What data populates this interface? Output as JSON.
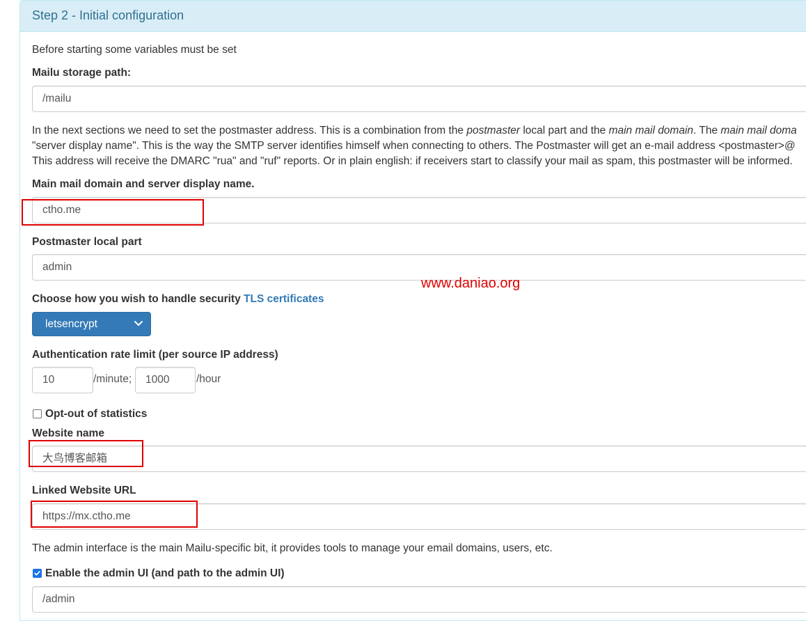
{
  "panel": {
    "title": "Step 2 - Initial configuration"
  },
  "intro_text": "Before starting some variables must be set",
  "storage": {
    "label": "Mailu storage path:",
    "value": "/mailu"
  },
  "postmaster_info": {
    "line1_a": "In the next sections we need to set the postmaster address. This is a combination from the ",
    "line1_em1": "postmaster",
    "line1_b": " local part and the ",
    "line1_em2": "main mail domain",
    "line1_c": ". The ",
    "line1_em3": "main mail doma",
    "line2": "\"server display name\". This is the way the SMTP server identifies himself when connecting to others. The Postmaster will get an e-mail address <postmaster>@",
    "line3": "This address will receive the DMARC \"rua\" and \"ruf\" reports. Or in plain english: if receivers start to classify your mail as spam, this postmaster will be informed."
  },
  "domain": {
    "label": "Main mail domain and server display name.",
    "value": "ctho.me"
  },
  "postmaster": {
    "label": "Postmaster local part",
    "value": "admin"
  },
  "watermark": "www.daniao.org",
  "tls": {
    "label": "Choose how you wish to handle security",
    "link": "TLS certificates",
    "selected": "letsencrypt"
  },
  "rate_limit": {
    "label": "Authentication rate limit (per source IP address)",
    "per_minute_value": "10",
    "per_minute_unit": "/minute;",
    "per_hour_value": "1000",
    "per_hour_unit": "/hour"
  },
  "statistics": {
    "label": "Opt-out of statistics",
    "checked": false
  },
  "website_name": {
    "label": "Website name",
    "value": "大鸟博客邮箱"
  },
  "website_url": {
    "label": "Linked Website URL",
    "value": "https://mx.ctho.me"
  },
  "admin_info": "The admin interface is the main Mailu-specific bit, it provides tools to manage your email domains, users, etc.",
  "admin_ui": {
    "label": "Enable the admin UI (and path to the admin UI)",
    "checked": true,
    "value": "/admin"
  },
  "colors": {
    "heading_bg": "#d9edf7",
    "heading_text": "#31708f",
    "primary": "#337ab7",
    "highlight": "#e00000"
  }
}
